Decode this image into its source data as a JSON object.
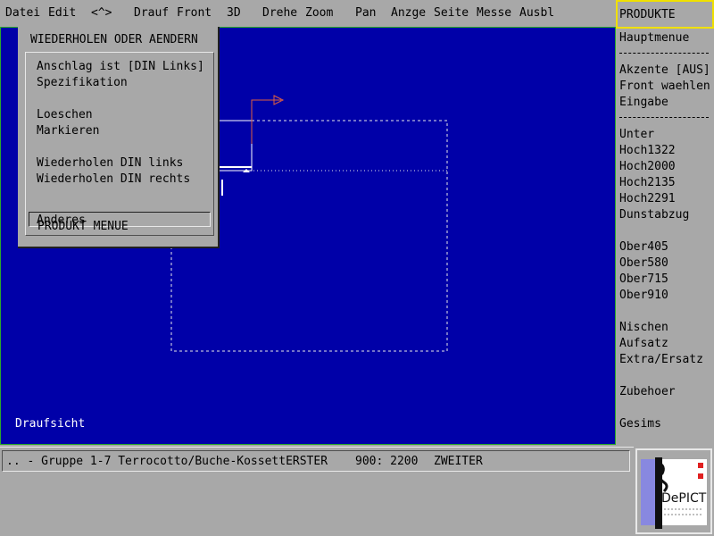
{
  "menubar": {
    "items": [
      "Datei",
      "Edit",
      "<^>",
      "Drauf",
      "Front",
      "3D",
      "Drehe",
      "Zoom",
      "Pan",
      "Anzge",
      "Seite",
      "Messe",
      "Ausbl"
    ]
  },
  "sidebar": {
    "header": "PRODUKTE",
    "items": [
      "Hauptmenue",
      "Akzente [AUS]",
      "Front waehlen",
      "Eingabe",
      "Unter",
      "Hoch1322",
      "Hoch2000",
      "Hoch2135",
      "Hoch2291",
      "Dunstabzug",
      "Ober405",
      "Ober580",
      "Ober715",
      "Ober910",
      "Nischen",
      "Aufsatz",
      "Extra/Ersatz",
      "Zubehoer",
      "Gesims"
    ]
  },
  "popup": {
    "title": "WIEDERHOLEN ODER AENDERN",
    "items": [
      "Anschlag ist [DIN Links]",
      "Spezifikation",
      "Loeschen",
      "Markieren",
      "Wiederholen DIN links",
      "Wiederholen DIN rechts",
      "Anderes",
      "PRODUKT MENUE"
    ],
    "selected": "Anderes"
  },
  "canvas": {
    "view_label": "Draufsicht"
  },
  "status": {
    "left": ".. - Gruppe 1-7 Terrocotto/Buche-KossettERSTER",
    "coords": "900: 2200",
    "mode": "ZWEITER"
  },
  "logo": {
    "text": "DePICT"
  },
  "colors": {
    "canvas": "#0000a8",
    "panel": "#a8a8a8",
    "header_border": "#f0e000",
    "arrow": "#e06040"
  }
}
